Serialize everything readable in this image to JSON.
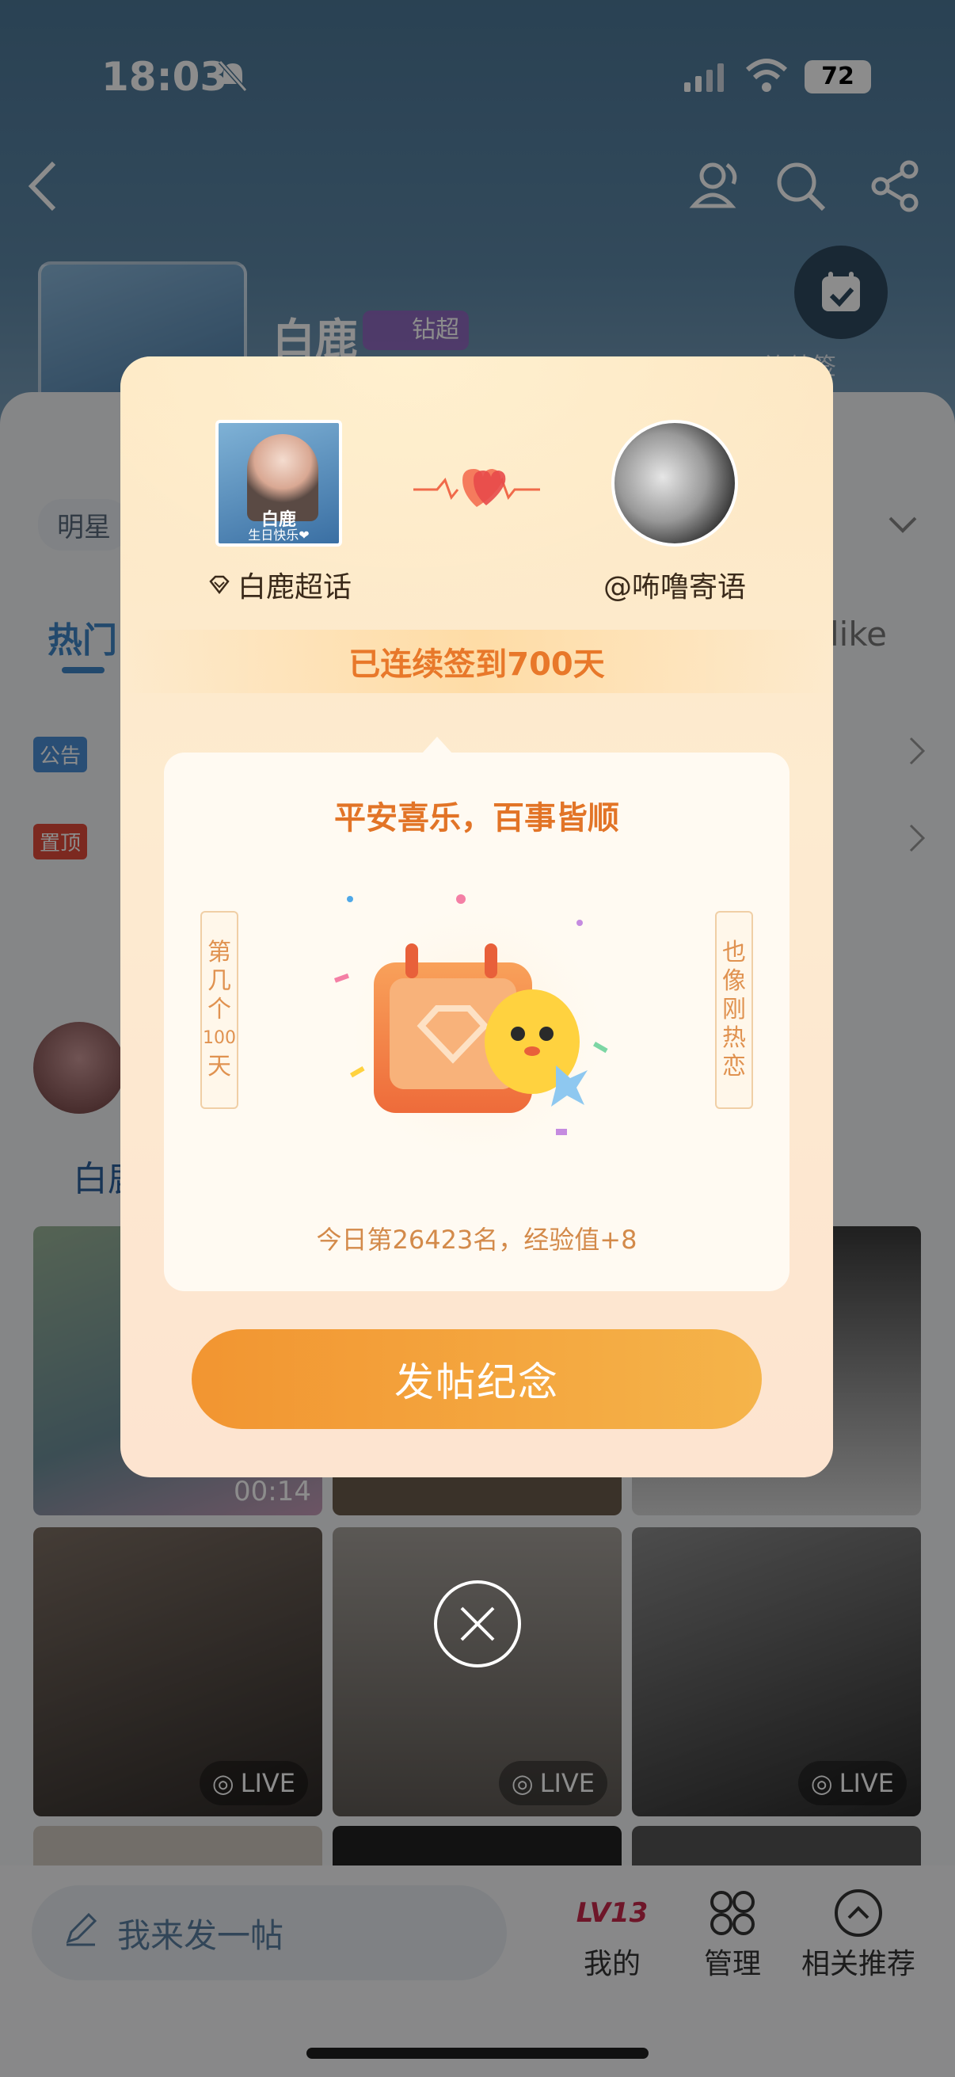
{
  "status_bar": {
    "time": "18:03",
    "battery": "72"
  },
  "profile": {
    "name": "白鹿",
    "badge": "钻超",
    "checkin_hint": "连续签"
  },
  "filter_chip": "明星",
  "tabs": {
    "hot": "热门",
    "like": "like"
  },
  "tags": {
    "announcement": "公告",
    "pinned": "置顶"
  },
  "feed": {
    "author_prefix": "白鹿",
    "video_duration": "00:14",
    "live_label": "LIVE"
  },
  "bottom_bar": {
    "post_placeholder": "我来发一帖",
    "level": "LV13",
    "mine": "我的",
    "manage": "管理",
    "related": "相关推荐"
  },
  "dialog": {
    "left_avatar_caption_1": "白鹿",
    "left_avatar_caption_2": "生日快乐❤",
    "left_name": "白鹿超话",
    "right_name": "@咘噜寄语",
    "streak_text": "已连续签到700天",
    "greeting": "平安喜乐，百事皆顺",
    "left_banner": [
      "第",
      "几",
      "个",
      "100",
      "天"
    ],
    "right_banner": [
      "也",
      "像",
      "刚",
      "热",
      "恋"
    ],
    "rank_text": "今日第26423名，经验值+8",
    "post_button": "发帖纪念"
  },
  "colors": {
    "accent_orange": "#e8782a",
    "button_start": "#f29531",
    "button_end": "#f5b44a"
  }
}
